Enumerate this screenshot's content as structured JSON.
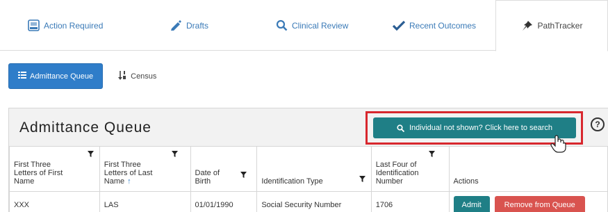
{
  "tabs": [
    {
      "label": "Action Required",
      "icon": "inbox-icon"
    },
    {
      "label": "Drafts",
      "icon": "pen-icon"
    },
    {
      "label": "Clinical Review",
      "icon": "search-icon"
    },
    {
      "label": "Recent Outcomes",
      "icon": "check-icon"
    },
    {
      "label": "PathTracker",
      "icon": "pin-icon"
    }
  ],
  "subnav": {
    "admittance": "Admittance Queue",
    "census": "Census"
  },
  "panel": {
    "title": "Admittance Queue",
    "search_button": "Individual not shown? Click here to search",
    "help": "?"
  },
  "table": {
    "headers": {
      "first_three_first": "First Three Letters of First Name",
      "first_three_last": "First Three Letters of Last Name",
      "dob": "Date of Birth",
      "id_type": "Identification Type",
      "last_four": "Last Four of Identification Number",
      "actions": "Actions"
    },
    "row": {
      "first": "XXX",
      "last": "LAS",
      "dob": "01/01/1990",
      "id_type": "Social Security Number",
      "last_four": "1706",
      "admit": "Admit",
      "remove": "Remove from Queue"
    }
  },
  "colors": {
    "link": "#3a7ab7",
    "primary": "#2f7dc9",
    "teal": "#1f7f86",
    "danger": "#d9534f",
    "highlight": "#d8272e"
  }
}
